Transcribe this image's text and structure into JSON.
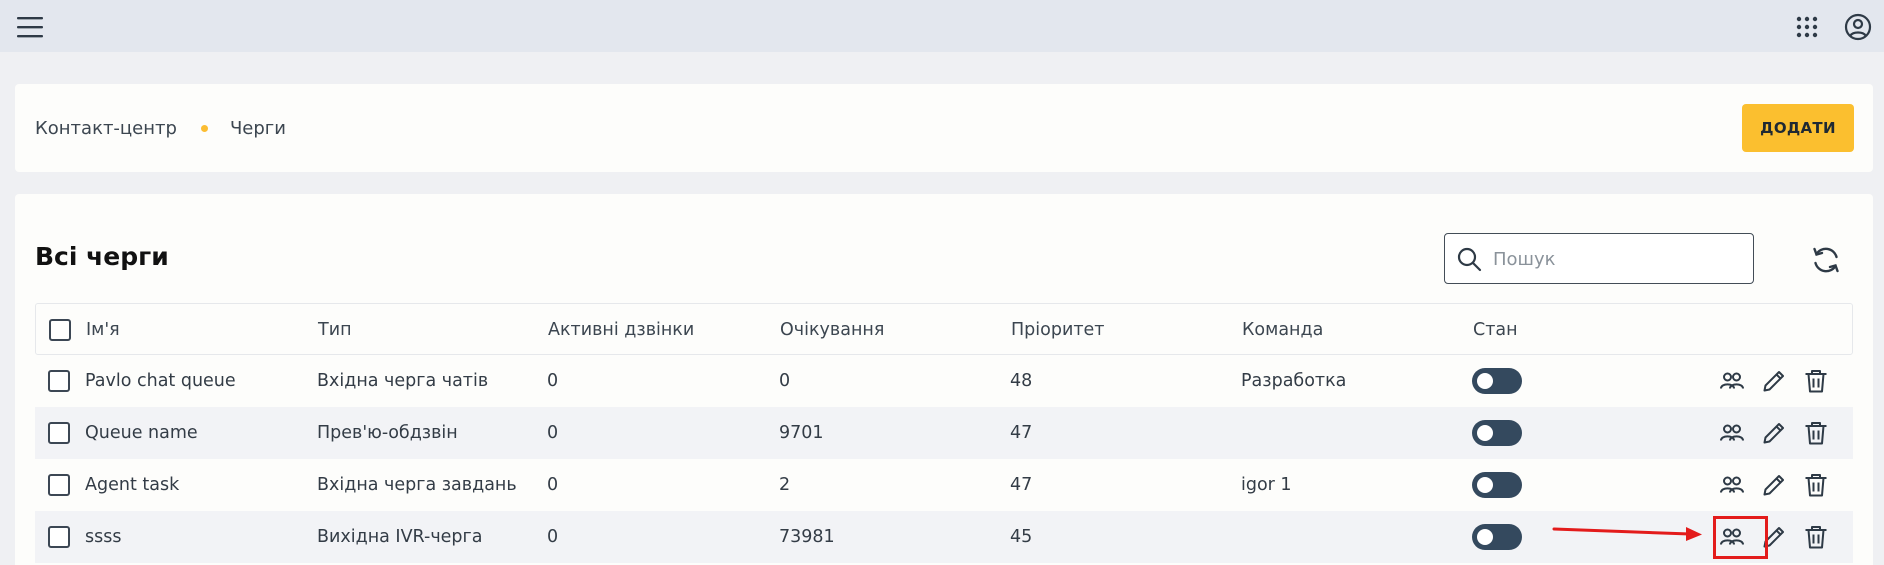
{
  "topbar": {
    "menu_icon": "hamburger-menu-icon",
    "apps_icon": "apps-grid-icon",
    "account_icon": "account-circle-icon"
  },
  "breadcrumb": {
    "items": [
      "Контакт-центр",
      "Черги"
    ]
  },
  "header": {
    "add_label": "ДОДАТИ"
  },
  "main": {
    "title": "Всі черги",
    "search": {
      "placeholder": "Пошук",
      "value": ""
    },
    "refresh_icon": "refresh-icon"
  },
  "table": {
    "columns": [
      "Ім'я",
      "Тип",
      "Активні дзвінки",
      "Очікування",
      "Пріоритет",
      "Команда",
      "Стан"
    ],
    "rows": [
      {
        "name": "Pavlo chat queue",
        "type": "Вхідна черга чатів",
        "active": "0",
        "waiting": "0",
        "priority": "48",
        "team": "Разработка",
        "state": false
      },
      {
        "name": "Queue name",
        "type": "Прев'ю-обдзвін",
        "active": "0",
        "waiting": "9701",
        "priority": "47",
        "team": "",
        "state": false
      },
      {
        "name": "Agent task",
        "type": "Вхідна черга завдань",
        "active": "0",
        "waiting": "2",
        "priority": "47",
        "team": "igor 1",
        "state": false
      },
      {
        "name": "ssss",
        "type": "Вихідна IVR-черга",
        "active": "0",
        "waiting": "73981",
        "priority": "45",
        "team": "",
        "state": false
      }
    ],
    "row_action_icons": [
      "members-icon",
      "edit-pencil-icon",
      "delete-trash-icon"
    ]
  },
  "annotation": {
    "color": "#e31b1b",
    "highlighted": "members-icon on row 4"
  },
  "colors": {
    "accent": "#fbbf2f",
    "toggle": "#34495e",
    "topbar": "#e3e7ee",
    "annotation": "#e31b1b"
  }
}
